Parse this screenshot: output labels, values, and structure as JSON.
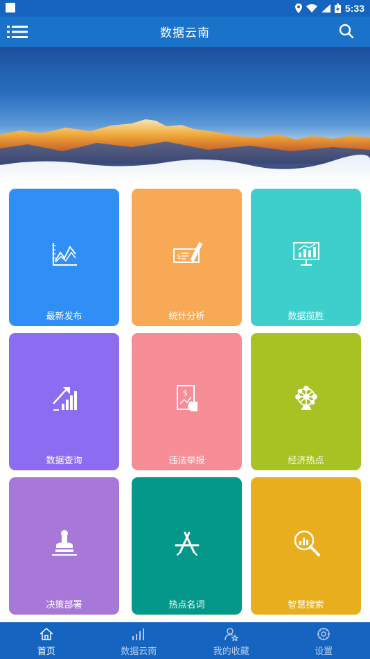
{
  "status_bar": {
    "time": "5:33"
  },
  "header": {
    "title": "数据云南"
  },
  "tiles": [
    {
      "label": "最新发布",
      "color": "#2f8ff7",
      "icon": "line-chart-icon"
    },
    {
      "label": "统计分析",
      "color": "#f9a955",
      "icon": "check-pen-icon"
    },
    {
      "label": "数据揽胜",
      "color": "#3ecfcd",
      "icon": "monitor-chart-icon"
    },
    {
      "label": "数据查询",
      "color": "#8c6cf0",
      "icon": "trend-bars-icon"
    },
    {
      "label": "违法举报",
      "color": "#f78d96",
      "icon": "report-tablet-icon"
    },
    {
      "label": "经济热点",
      "color": "#a7c222",
      "icon": "network-globe-icon"
    },
    {
      "label": "决策部署",
      "color": "#a878d8",
      "icon": "stamp-icon"
    },
    {
      "label": "热点名词",
      "color": "#04988a",
      "icon": "app-store-icon"
    },
    {
      "label": "智慧搜索",
      "color": "#e9ae1e",
      "icon": "search-chart-icon"
    }
  ],
  "tabs": [
    {
      "label": "首页",
      "icon": "home-icon",
      "active": true
    },
    {
      "label": "数据云南",
      "icon": "bar-chart-icon",
      "active": false
    },
    {
      "label": "我的收藏",
      "icon": "user-star-icon",
      "active": false
    },
    {
      "label": "设置",
      "icon": "gear-icon",
      "active": false
    }
  ]
}
